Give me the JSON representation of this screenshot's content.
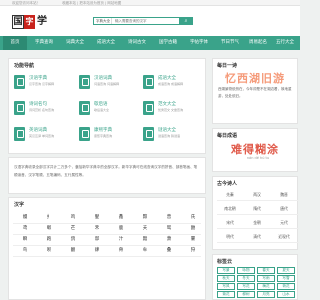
{
  "topbar": {
    "left_text": "欢迎您访问本站！",
    "right_text": "收藏本站 | 把本站设为首页 | 网站地图"
  },
  "logo": {
    "char1": "国",
    "seal": "字",
    "char3": "学"
  },
  "search": {
    "select_label": "字典大全",
    "placeholder": "输入需要查询的汉字",
    "button_glyph": "⌕"
  },
  "nav": {
    "items": [
      "首页",
      "字典查询",
      "词典大全",
      "成语大全",
      "诗词古文",
      "国学古籍",
      "字帖字体",
      "节日节气",
      "周易起名",
      "五行大全"
    ]
  },
  "features": {
    "title": "功能导航",
    "items": [
      {
        "title": "汉语字典",
        "desc": "汉字查询 汉字解释"
      },
      {
        "title": "汉语词典",
        "desc": "词语查询 词语解释"
      },
      {
        "title": "成语大全",
        "desc": "成语查询 成语解释"
      },
      {
        "title": "诗词名句",
        "desc": "诗词赏析 名句查询"
      },
      {
        "title": "歇后语",
        "desc": "歇后语大全"
      },
      {
        "title": "范文大全",
        "desc": "优秀范文 文章查询"
      },
      {
        "title": "英语词典",
        "desc": "英汉互译 单词查询"
      },
      {
        "title": "康熙字典",
        "desc": "康熙字典查询"
      },
      {
        "title": "谜语大全",
        "desc": "谜语查询 猜谜语"
      }
    ]
  },
  "intro": {
    "text": "汉语字典收录全部汉字共计二万多个，囊括新华字典中的全部汉字。新华字典可在线查询汉字的拼音、部首笔画、笔顺读音、汉字笔顺、五笔编码、五行属性等。"
  },
  "hanzi": {
    "title": "汉字",
    "chars": [
      "嫚",
      "扌",
      "鸡",
      "髮",
      "鑫",
      "黥",
      "曾",
      "氏",
      "鸢",
      "嗽",
      "芒",
      "禾",
      "鹿",
      "夭",
      "鸳",
      "酏",
      "瞬",
      "跑",
      "鸽",
      "邸",
      "汁",
      "黯",
      "萧",
      "霎",
      "鸟",
      "呗",
      "翻",
      "肆",
      "骨",
      "牟",
      "叠",
      "狩"
    ]
  },
  "poem": {
    "title": "每日一诗",
    "big": "忆西湖旧游",
    "lines": "西湖景物依然在，今年却是不在湖边看，故地重游，处处依旧。"
  },
  "idiom": {
    "title": "每日成语",
    "big": "难得糊涂",
    "sub": "nán dé hú tu"
  },
  "dynasty": {
    "title": "古今诗人",
    "items": [
      "先秦",
      "两汉",
      "魏晋",
      "南北朝",
      "隋代",
      "唐代",
      "宋代",
      "金朝",
      "元代",
      "明代",
      "清代",
      "近现代"
    ]
  },
  "tags": {
    "title": "标签云",
    "items": [
      "写景",
      "咏物",
      "春天",
      "夏天",
      "秋天",
      "冬天",
      "写雨",
      "写雪",
      "写风",
      "写花",
      "梅花",
      "荷花",
      "菊花",
      "柳树",
      "月亮",
      "山水",
      "写山",
      "写水",
      "长江",
      "黄河"
    ]
  },
  "colors": {
    "accent": "#3aa38a",
    "poem": "#f59b7a",
    "idiom": "#e05b4b"
  }
}
